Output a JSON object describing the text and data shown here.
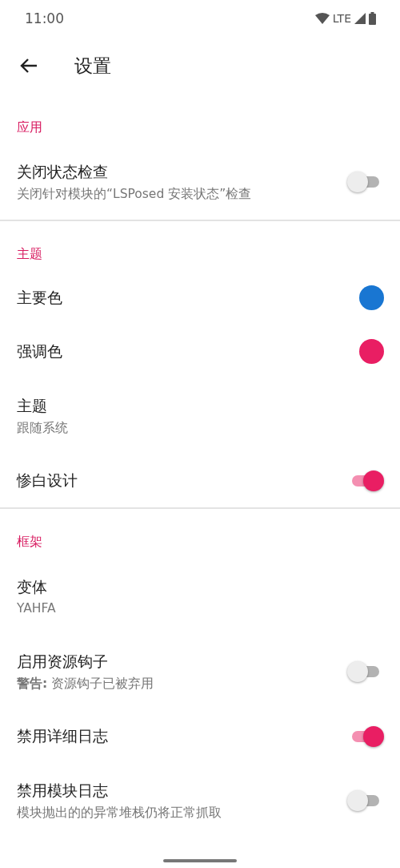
{
  "status_bar": {
    "time": "11:00",
    "network": "LTE"
  },
  "toolbar": {
    "title": "设置"
  },
  "sections": [
    {
      "header": "应用",
      "items": [
        {
          "kind": "switch",
          "title": "关闭状态检查",
          "summary": "关闭针对模块的“LSPosed 安装状态”检查",
          "on": false
        }
      ]
    },
    {
      "header": "主题",
      "items": [
        {
          "kind": "color",
          "title": "主要色",
          "color": "#1976d2"
        },
        {
          "kind": "color",
          "title": "强调色",
          "color": "#e91e63"
        },
        {
          "kind": "text",
          "title": "主题",
          "summary": "跟随系统"
        },
        {
          "kind": "switch",
          "title": "惨白设计",
          "on": true
        }
      ]
    },
    {
      "header": "框架",
      "items": [
        {
          "kind": "text",
          "title": "变体",
          "summary": "YAHFA"
        },
        {
          "kind": "switch",
          "title": "启用资源钩子",
          "summary": "**警告:** 资源钩子已被弃用",
          "on": false
        },
        {
          "kind": "switch",
          "title": "禁用详细日志",
          "on": true
        },
        {
          "kind": "switch",
          "title": "禁用模块日志",
          "summary": "模块抛出的的异常堆栈仍将正常抓取",
          "on": false
        }
      ]
    }
  ]
}
